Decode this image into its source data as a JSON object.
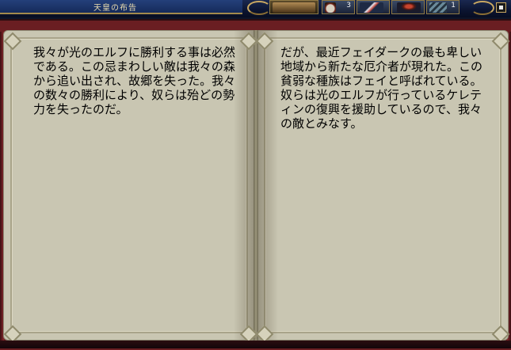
{
  "window": {
    "title": "天皇の布告"
  },
  "hud": {
    "slots": [
      {
        "icon": "portrait-icon",
        "count": ""
      },
      {
        "icon": "bag-icon",
        "count": "3"
      },
      {
        "icon": "weapon-icon",
        "count": ""
      },
      {
        "icon": "figure-icon",
        "count": ""
      },
      {
        "icon": "chain-icon",
        "count": "1"
      }
    ]
  },
  "book": {
    "left_page": "我々が光のエルフに勝利する事は必然である。この忌まわしい敵は我々の森から追い出され、故郷を失った。我々の数々の勝利により、奴らは殆どの勢力を失ったのだ。",
    "right_page": "だが、最近フェイダークの最も卑しい地域から新たな厄介者が現れた。この貧弱な種族はフェイと呼ばれている。奴らは光のエルフが行っているケレティンの復興を援助しているので、我々の敵とみなす。"
  },
  "colors": {
    "page": "#c9c6b2",
    "cover": "#6a1e22",
    "frame_gold": "#c9a862",
    "hud_bg": "#0b1430"
  }
}
